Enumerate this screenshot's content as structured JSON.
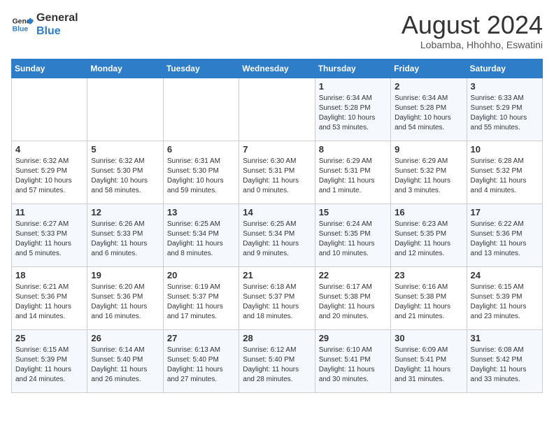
{
  "header": {
    "logo_line1": "General",
    "logo_line2": "Blue",
    "month_year": "August 2024",
    "location": "Lobamba, Hhohho, Eswatini"
  },
  "weekdays": [
    "Sunday",
    "Monday",
    "Tuesday",
    "Wednesday",
    "Thursday",
    "Friday",
    "Saturday"
  ],
  "weeks": [
    [
      {
        "day": "",
        "info": ""
      },
      {
        "day": "",
        "info": ""
      },
      {
        "day": "",
        "info": ""
      },
      {
        "day": "",
        "info": ""
      },
      {
        "day": "1",
        "info": "Sunrise: 6:34 AM\nSunset: 5:28 PM\nDaylight: 10 hours and 53 minutes."
      },
      {
        "day": "2",
        "info": "Sunrise: 6:34 AM\nSunset: 5:28 PM\nDaylight: 10 hours and 54 minutes."
      },
      {
        "day": "3",
        "info": "Sunrise: 6:33 AM\nSunset: 5:29 PM\nDaylight: 10 hours and 55 minutes."
      }
    ],
    [
      {
        "day": "4",
        "info": "Sunrise: 6:32 AM\nSunset: 5:29 PM\nDaylight: 10 hours and 57 minutes."
      },
      {
        "day": "5",
        "info": "Sunrise: 6:32 AM\nSunset: 5:30 PM\nDaylight: 10 hours and 58 minutes."
      },
      {
        "day": "6",
        "info": "Sunrise: 6:31 AM\nSunset: 5:30 PM\nDaylight: 10 hours and 59 minutes."
      },
      {
        "day": "7",
        "info": "Sunrise: 6:30 AM\nSunset: 5:31 PM\nDaylight: 11 hours and 0 minutes."
      },
      {
        "day": "8",
        "info": "Sunrise: 6:29 AM\nSunset: 5:31 PM\nDaylight: 11 hours and 1 minute."
      },
      {
        "day": "9",
        "info": "Sunrise: 6:29 AM\nSunset: 5:32 PM\nDaylight: 11 hours and 3 minutes."
      },
      {
        "day": "10",
        "info": "Sunrise: 6:28 AM\nSunset: 5:32 PM\nDaylight: 11 hours and 4 minutes."
      }
    ],
    [
      {
        "day": "11",
        "info": "Sunrise: 6:27 AM\nSunset: 5:33 PM\nDaylight: 11 hours and 5 minutes."
      },
      {
        "day": "12",
        "info": "Sunrise: 6:26 AM\nSunset: 5:33 PM\nDaylight: 11 hours and 6 minutes."
      },
      {
        "day": "13",
        "info": "Sunrise: 6:25 AM\nSunset: 5:34 PM\nDaylight: 11 hours and 8 minutes."
      },
      {
        "day": "14",
        "info": "Sunrise: 6:25 AM\nSunset: 5:34 PM\nDaylight: 11 hours and 9 minutes."
      },
      {
        "day": "15",
        "info": "Sunrise: 6:24 AM\nSunset: 5:35 PM\nDaylight: 11 hours and 10 minutes."
      },
      {
        "day": "16",
        "info": "Sunrise: 6:23 AM\nSunset: 5:35 PM\nDaylight: 11 hours and 12 minutes."
      },
      {
        "day": "17",
        "info": "Sunrise: 6:22 AM\nSunset: 5:36 PM\nDaylight: 11 hours and 13 minutes."
      }
    ],
    [
      {
        "day": "18",
        "info": "Sunrise: 6:21 AM\nSunset: 5:36 PM\nDaylight: 11 hours and 14 minutes."
      },
      {
        "day": "19",
        "info": "Sunrise: 6:20 AM\nSunset: 5:36 PM\nDaylight: 11 hours and 16 minutes."
      },
      {
        "day": "20",
        "info": "Sunrise: 6:19 AM\nSunset: 5:37 PM\nDaylight: 11 hours and 17 minutes."
      },
      {
        "day": "21",
        "info": "Sunrise: 6:18 AM\nSunset: 5:37 PM\nDaylight: 11 hours and 18 minutes."
      },
      {
        "day": "22",
        "info": "Sunrise: 6:17 AM\nSunset: 5:38 PM\nDaylight: 11 hours and 20 minutes."
      },
      {
        "day": "23",
        "info": "Sunrise: 6:16 AM\nSunset: 5:38 PM\nDaylight: 11 hours and 21 minutes."
      },
      {
        "day": "24",
        "info": "Sunrise: 6:15 AM\nSunset: 5:39 PM\nDaylight: 11 hours and 23 minutes."
      }
    ],
    [
      {
        "day": "25",
        "info": "Sunrise: 6:15 AM\nSunset: 5:39 PM\nDaylight: 11 hours and 24 minutes."
      },
      {
        "day": "26",
        "info": "Sunrise: 6:14 AM\nSunset: 5:40 PM\nDaylight: 11 hours and 26 minutes."
      },
      {
        "day": "27",
        "info": "Sunrise: 6:13 AM\nSunset: 5:40 PM\nDaylight: 11 hours and 27 minutes."
      },
      {
        "day": "28",
        "info": "Sunrise: 6:12 AM\nSunset: 5:40 PM\nDaylight: 11 hours and 28 minutes."
      },
      {
        "day": "29",
        "info": "Sunrise: 6:10 AM\nSunset: 5:41 PM\nDaylight: 11 hours and 30 minutes."
      },
      {
        "day": "30",
        "info": "Sunrise: 6:09 AM\nSunset: 5:41 PM\nDaylight: 11 hours and 31 minutes."
      },
      {
        "day": "31",
        "info": "Sunrise: 6:08 AM\nSunset: 5:42 PM\nDaylight: 11 hours and 33 minutes."
      }
    ]
  ]
}
